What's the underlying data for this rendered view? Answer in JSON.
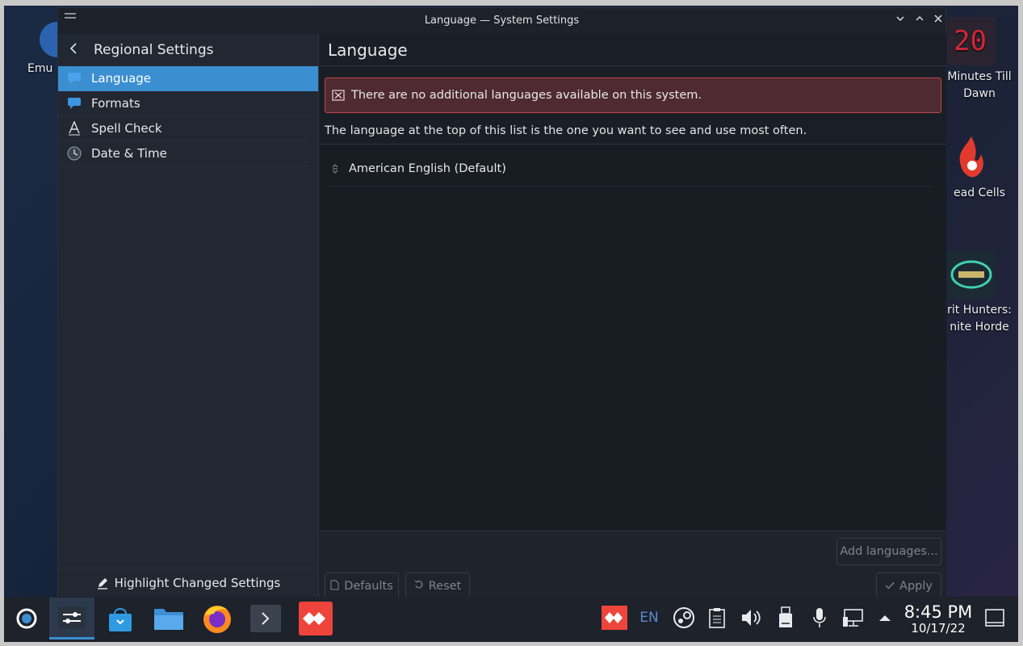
{
  "window": {
    "title": "Language — System Settings",
    "controls": [
      "chevron-down-icon",
      "chevron-up-icon",
      "close-icon"
    ]
  },
  "sidebar": {
    "header": "Regional Settings",
    "items": [
      {
        "label": "Language",
        "icon": "language-icon",
        "active": true
      },
      {
        "label": "Formats",
        "icon": "formats-icon",
        "active": false
      },
      {
        "label": "Spell Check",
        "icon": "spellcheck-icon",
        "active": false
      },
      {
        "label": "Date & Time",
        "icon": "clock-icon",
        "active": false
      }
    ],
    "footer": "Highlight Changed Settings"
  },
  "content": {
    "heading": "Language",
    "error": "There are no additional languages available on this system.",
    "hint": "The language at the top of this list is the one you want to see and use most often.",
    "languages": [
      "American English (Default)"
    ],
    "buttons": {
      "add": "Add languages...",
      "defaults": "Defaults",
      "reset": "Reset",
      "apply": "Apply"
    }
  },
  "desktop": {
    "left_icon": "Emu",
    "icons": [
      {
        "line1": "Minutes Till",
        "line2": "Dawn",
        "badge": "20"
      },
      {
        "line1": "ead Cells",
        "line2": ""
      },
      {
        "line1": "rit Hunters:",
        "line2": "nite Horde"
      }
    ]
  },
  "taskbar": {
    "language": "EN",
    "time": "8:45 PM",
    "date": "10/17/22"
  },
  "colors": {
    "accent": "#3b8fd0",
    "error_bg": "#4f2a30",
    "error_border": "#c1454d",
    "window_bg": "#1b1f27"
  }
}
